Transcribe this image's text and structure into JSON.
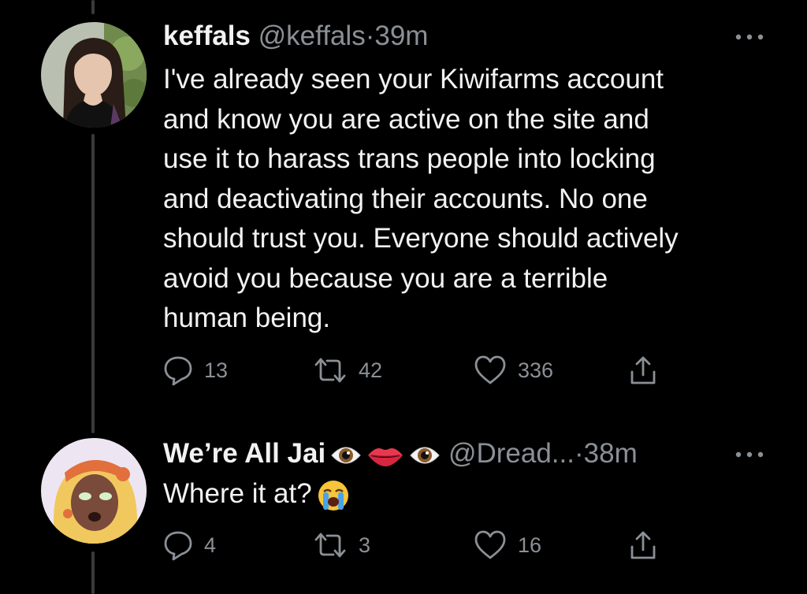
{
  "tweets": [
    {
      "name": "keffals",
      "handle": "@keffals",
      "separator": "·",
      "time": "39m",
      "text_lines": [
        "I've already seen your Kiwifarms account",
        "and know you are active on the site and",
        "use it to harass trans people into locking",
        "and deactivating their accounts. No one",
        "should trust you. Everyone should actively",
        "avoid you because you are a terrible",
        "human being."
      ],
      "replies": "13",
      "retweets": "42",
      "likes": "336"
    },
    {
      "name": "We’re All Jai",
      "name_emoji": [
        "eye-emoji",
        "lips-emoji",
        "eye-emoji"
      ],
      "handle": "@Dread...",
      "separator": "·",
      "time": "38m",
      "text": "Where it at?",
      "text_emoji": "loudly-crying-face-emoji",
      "replies": "4",
      "retweets": "3",
      "likes": "16"
    }
  ],
  "colors": {
    "background": "#000000",
    "text": "#f2f2f2",
    "secondary": "#8b9096",
    "thread_line": "#3a3a3c"
  },
  "icons": [
    "reply-icon",
    "retweet-icon",
    "like-icon",
    "share-icon",
    "more-options-icon"
  ]
}
